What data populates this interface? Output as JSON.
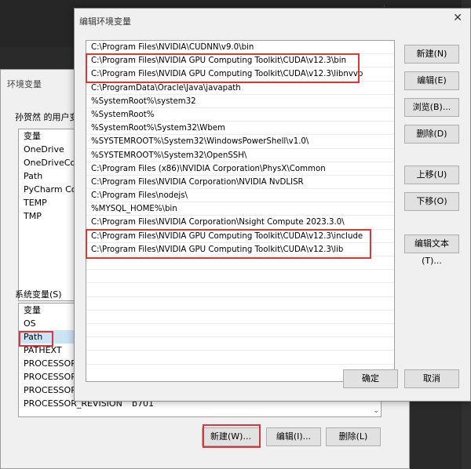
{
  "desktop_note_lines": [
    "·",
    "·",
    "·"
  ],
  "env_window": {
    "title": "环境变量",
    "user_vars_label": "孙贺然 的用户变量",
    "user_vars": [
      "变量",
      "OneDrive",
      "OneDriveCom",
      "Path",
      "PyCharm Com",
      "TEMP",
      "TMP"
    ],
    "system_vars_label": "系统变量(S)",
    "system_vars": [
      {
        "name": "变量",
        "value": ""
      },
      {
        "name": "OS",
        "value": ""
      },
      {
        "name": "Path",
        "value": ""
      },
      {
        "name": "PATHEXT",
        "value": ""
      },
      {
        "name": "PROCESSOR_A",
        "value": ""
      },
      {
        "name": "PROCESSOR_I",
        "value": ""
      },
      {
        "name": "PROCESSOR_L",
        "value": ""
      },
      {
        "name": "PROCESSOR_REVISION",
        "value": "b701"
      }
    ],
    "buttons": {
      "new": "新建(W)...",
      "edit": "编辑(I)...",
      "delete": "删除(L)"
    }
  },
  "edit_dialog": {
    "title": "编辑环境变量",
    "close": "✕",
    "paths": [
      "C:\\Program Files\\NVIDIA\\CUDNN\\v9.0\\bin",
      "C:\\Program Files\\NVIDIA GPU Computing Toolkit\\CUDA\\v12.3\\bin",
      "C:\\Program Files\\NVIDIA GPU Computing Toolkit\\CUDA\\v12.3\\libnvvp",
      "C:\\ProgramData\\Oracle\\Java\\javapath",
      "%SystemRoot%\\system32",
      "%SystemRoot%",
      "%SystemRoot%\\System32\\Wbem",
      "%SYSTEMROOT%\\System32\\WindowsPowerShell\\v1.0\\",
      "%SYSTEMROOT%\\System32\\OpenSSH\\",
      "C:\\Program Files (x86)\\NVIDIA Corporation\\PhysX\\Common",
      "C:\\Program Files\\NVIDIA Corporation\\NVIDIA NvDLISR",
      "C:\\Program Files\\nodejs\\",
      "%MYSQL_HOME%\\bin",
      "C:\\Program Files\\NVIDIA Corporation\\Nsight Compute 2023.3.0\\",
      "C:\\Program Files\\NVIDIA GPU Computing Toolkit\\CUDA\\v12.3\\include",
      "C:\\Program Files\\NVIDIA GPU Computing Toolkit\\CUDA\\v12.3\\lib"
    ],
    "buttons": {
      "new": "新建(N)",
      "edit": "编辑(E)",
      "browse": "浏览(B)...",
      "delete": "删除(D)",
      "move_up": "上移(U)",
      "move_down": "下移(O)",
      "edit_text": "编辑文本(T)...",
      "ok": "确定",
      "cancel": "取消"
    }
  },
  "colors": {
    "highlight": "#d9383a",
    "selection": "#cce4f7"
  }
}
